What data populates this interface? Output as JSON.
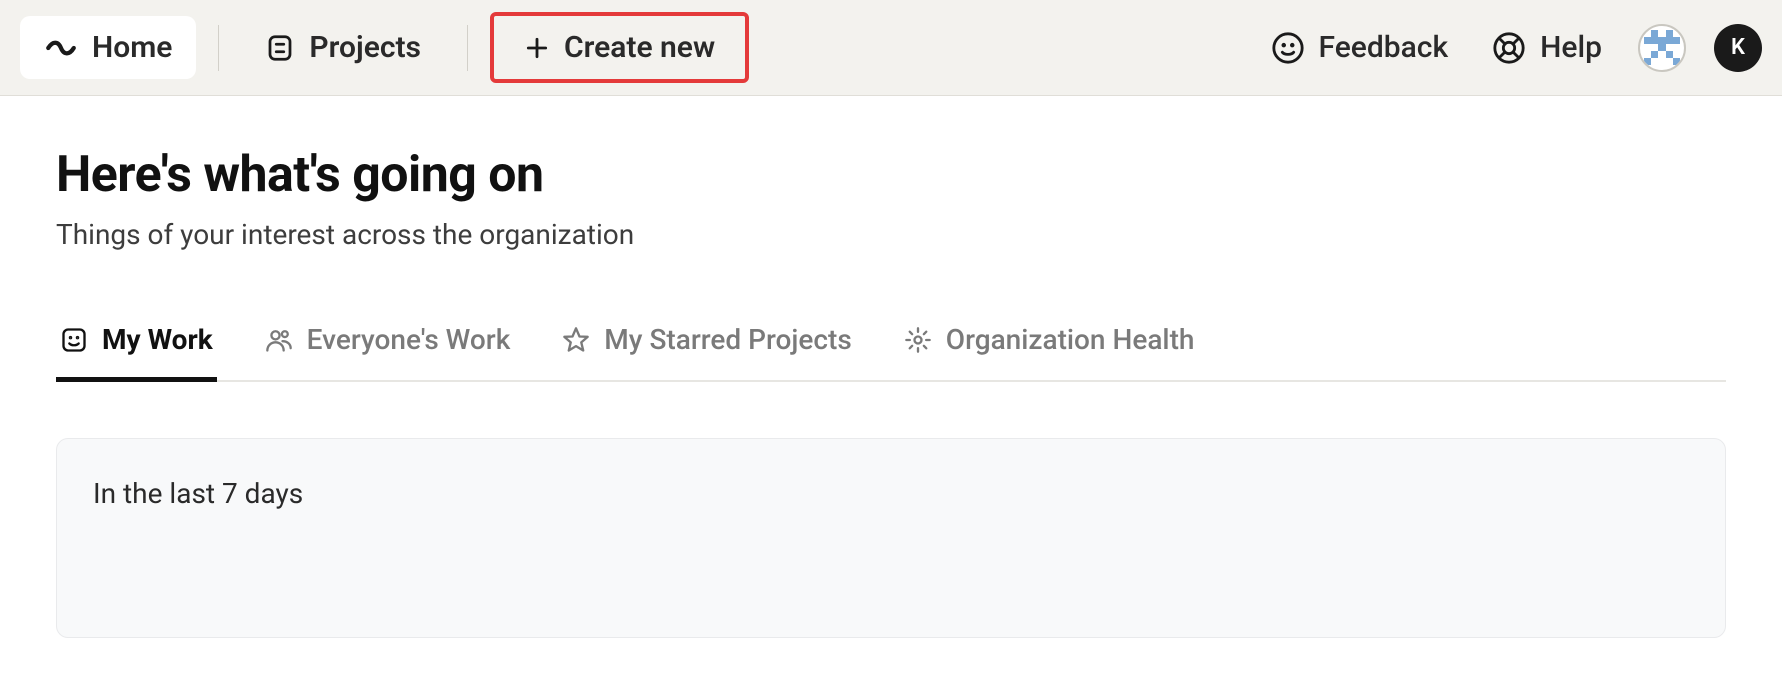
{
  "topbar": {
    "home_label": "Home",
    "projects_label": "Projects",
    "create_label": "Create new",
    "feedback_label": "Feedback",
    "help_label": "Help",
    "user_initial": "K"
  },
  "page": {
    "title": "Here's what's going on",
    "subtitle": "Things of your interest across the organization"
  },
  "tabs": {
    "my_work": "My Work",
    "everyones_work": "Everyone's Work",
    "starred": "My Starred Projects",
    "org_health": "Organization Health"
  },
  "panel": {
    "heading": "In the last 7 days"
  }
}
